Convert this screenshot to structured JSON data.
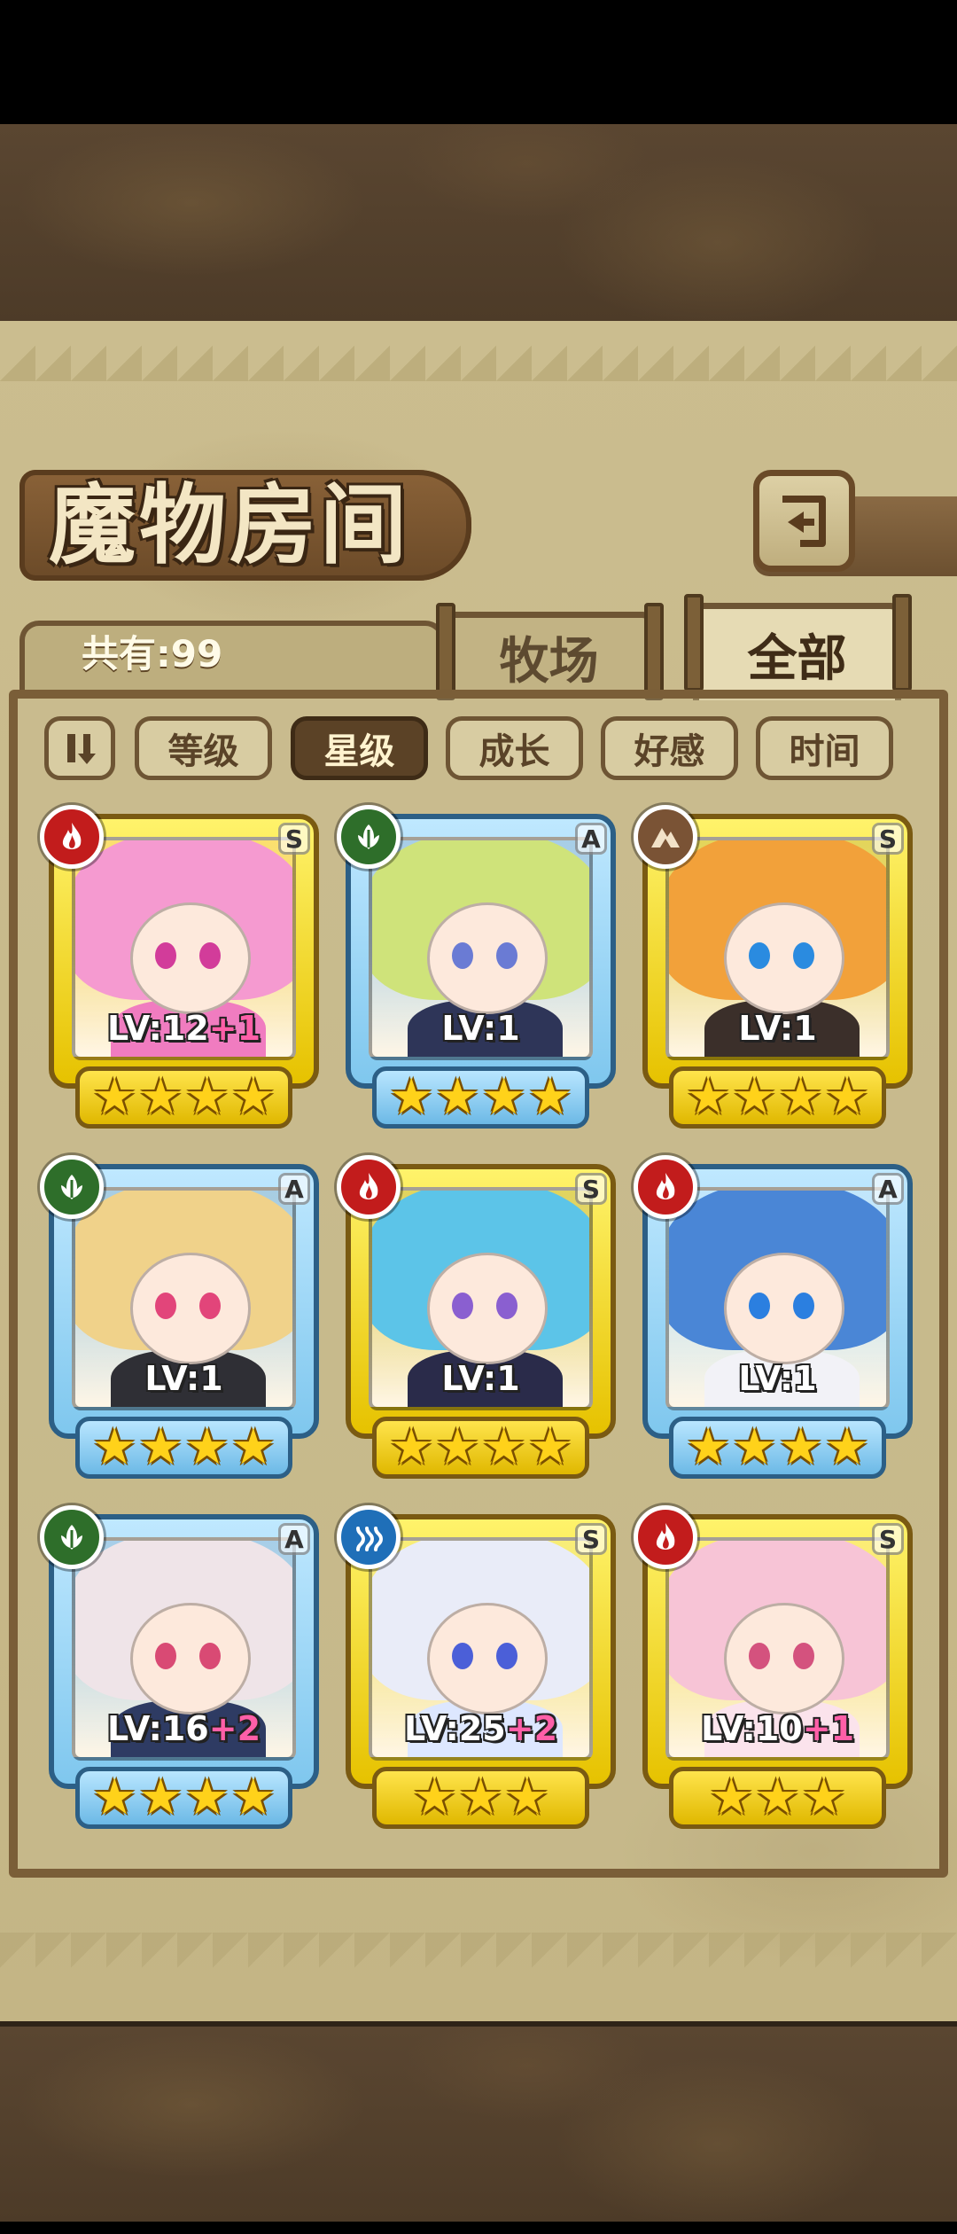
{
  "header": {
    "title": "魔物房间"
  },
  "tabs": {
    "count_label": "共有:99",
    "ranch": "牧场",
    "all": "全部"
  },
  "sort": {
    "buttons": [
      "等级",
      "星级",
      "成长",
      "好感",
      "时间"
    ],
    "active_index": 1
  },
  "monsters": [
    {
      "rank": "S",
      "element": "fire",
      "level": "LV:12",
      "bonus": "+1",
      "stars": 4,
      "hair": "#f59ad0",
      "eyes": "#d23c9a",
      "body": "#f07cc0"
    },
    {
      "rank": "A",
      "element": "grass",
      "level": "LV:1",
      "bonus": "",
      "stars": 4,
      "hair": "#cfe37a",
      "eyes": "#6a7bd4",
      "body": "#2e3558"
    },
    {
      "rank": "S",
      "element": "rock",
      "level": "LV:1",
      "bonus": "",
      "stars": 4,
      "hair": "#f2a13a",
      "eyes": "#2a8be0",
      "body": "#3b2f2a"
    },
    {
      "rank": "A",
      "element": "grass",
      "level": "LV:1",
      "bonus": "",
      "stars": 4,
      "hair": "#f0d28a",
      "eyes": "#e2457a",
      "body": "#2f2f35"
    },
    {
      "rank": "S",
      "element": "fire",
      "level": "LV:1",
      "bonus": "",
      "stars": 4,
      "hair": "#5cc4e8",
      "eyes": "#8a5fd0",
      "body": "#2a2b4a"
    },
    {
      "rank": "A",
      "element": "fire",
      "level": "LV:1",
      "bonus": "",
      "stars": 4,
      "hair": "#4a86d6",
      "eyes": "#2b7fe0",
      "body": "#f2f2f7"
    },
    {
      "rank": "A",
      "element": "grass",
      "level": "LV:16",
      "bonus": "+2",
      "stars": 4,
      "hair": "#efe4e8",
      "eyes": "#d94a74",
      "body": "#2e3b63"
    },
    {
      "rank": "S",
      "element": "water",
      "level": "LV:25",
      "bonus": "+2",
      "stars": 3,
      "hair": "#e9ecf8",
      "eyes": "#4b5fd8",
      "body": "#dde7ff"
    },
    {
      "rank": "S",
      "element": "fire",
      "level": "LV:10",
      "bonus": "+1",
      "stars": 3,
      "hair": "#f7c4d6",
      "eyes": "#d4527e",
      "body": "#fbe3ec"
    }
  ],
  "icons": {
    "back": "back-arrow-icon",
    "sort_toggle": "sort-order-icon",
    "fire": "fire-icon",
    "grass": "leaf-icon",
    "rock": "rock-icon",
    "water": "water-icon"
  },
  "colors": {
    "panel": "#c8b988",
    "frame": "#7a5e38",
    "s_card": "#f0d21c",
    "a_card": "#8fd0f2",
    "active_sort": "#5b4226",
    "bonus": "#ff5fa8"
  }
}
